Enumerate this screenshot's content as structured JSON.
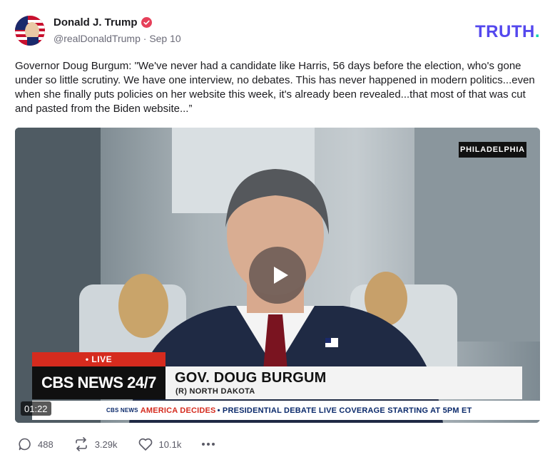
{
  "post": {
    "author_name": "Donald J. Trump",
    "author_handle": "@realDonaldTrump",
    "separator": "·",
    "date": "Sep 10",
    "text": "Governor Doug Burgum: \"We've never had a candidate like Harris, 56 days before the election, who's gone under so little scrutiny. We have one interview, no debates. This has never happened in modern politics...even when she finally puts policies on her website this week, it's already been revealed...that most of that was cut and pasted from the Biden website...”"
  },
  "brand": {
    "logo_text": "TRUTH",
    "logo_dot": ".",
    "color": "#5448ee",
    "dot_color": "#00d1b2"
  },
  "video": {
    "location_tag": "PHILADELPHIA",
    "live_label": "• LIVE",
    "network": "CBS NEWS 24/7",
    "lower_third_name": "GOV. DOUG BURGUM",
    "lower_third_sub": "(R) NORTH DAKOTA",
    "ticker_network": "CBS NEWS",
    "ticker_program": "AMERICA DECIDES",
    "ticker_text": "• PRESIDENTIAL DEBATE LIVE COVERAGE STARTING AT 5PM ET",
    "duration": "01:22"
  },
  "actions": {
    "replies": "488",
    "retruths": "3.29k",
    "likes": "10.1k"
  },
  "icons": {
    "verified": "verified-badge-icon",
    "play": "play-icon",
    "reply": "reply-icon",
    "retruth": "retruth-icon",
    "like": "heart-icon",
    "more": "more-icon"
  }
}
